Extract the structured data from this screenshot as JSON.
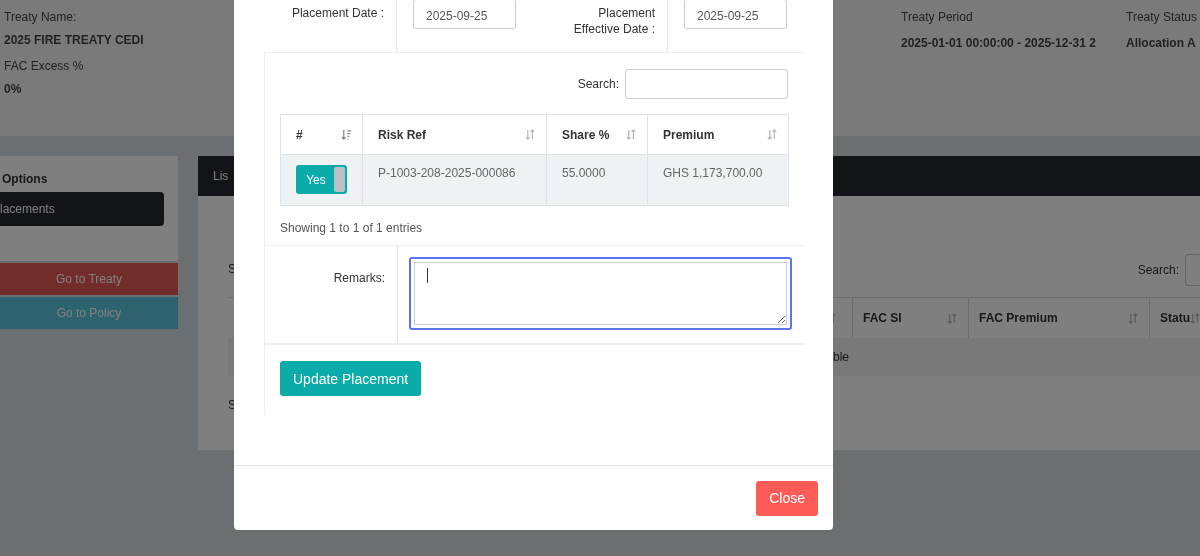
{
  "info_fields": [
    {
      "label": "Treaty Name:",
      "value": "2025 FIRE TREATY CEDI"
    },
    {
      "label": "FAC Excess %",
      "value": "0%"
    },
    {
      "label": "Treaty Period",
      "value": "2025-01-01 00:00:00 - 2025-12-31 2"
    },
    {
      "label": "Treaty Status",
      "value": "Allocation A"
    }
  ],
  "sidebar": {
    "title": "Options",
    "items": [
      {
        "label": "lacements",
        "selected": true
      }
    ]
  },
  "links": [
    {
      "label": "Go to Treaty",
      "kind": "danger"
    },
    {
      "label": "Go to Policy",
      "kind": "info"
    }
  ],
  "list_card": {
    "header": "Lis",
    "length_text": "S",
    "search_label": "Search:",
    "columns": [
      {
        "label": "FAC SI"
      },
      {
        "label": "FAC Premium"
      },
      {
        "label": "Statu"
      }
    ],
    "empty_text": "ble",
    "info_text": "S"
  },
  "modal": {
    "placement_date": {
      "label": "Placement Date :",
      "value": "2025-09-25"
    },
    "effective_date": {
      "label": "Placement Effective Date :",
      "value": "2025-09-25"
    },
    "search_label": "Search:",
    "table": {
      "columns": [
        {
          "label": "#",
          "sorted": true
        },
        {
          "label": "Risk Ref",
          "sorted": false
        },
        {
          "label": "Share %",
          "sorted": false
        },
        {
          "label": "Premium",
          "sorted": false
        }
      ],
      "rows": [
        {
          "toggle": {
            "label": "Yes",
            "on": true
          },
          "risk_ref": "P-1003-208-2025-000086",
          "share": "55.0000",
          "premium": "GHS 1,173,700.00"
        }
      ]
    },
    "info": "Showing 1 to 1 of 1 entries",
    "remarks": {
      "label": "Remarks:",
      "focused": true
    },
    "update_button": "Update Placement",
    "close_button": "Close"
  }
}
